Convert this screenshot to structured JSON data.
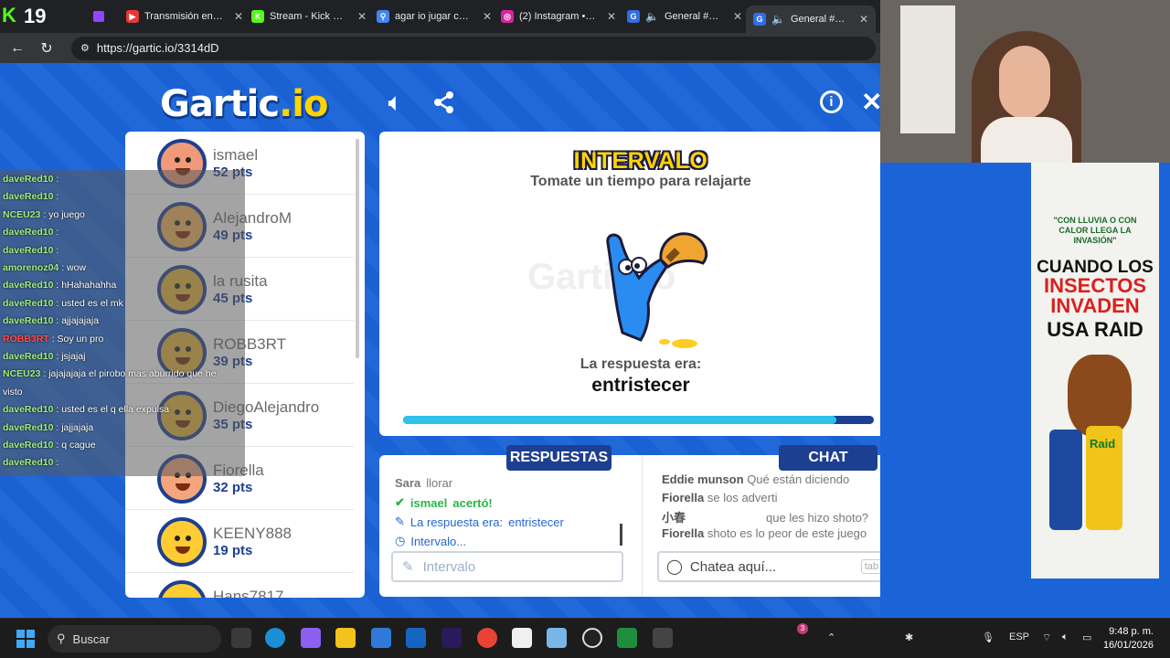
{
  "browser": {
    "stream_number": "19",
    "tabs": [
      {
        "label": "Transmisión en vivo",
        "fav_color": "#e53935",
        "fav_glyph": "▶"
      },
      {
        "label": "Stream - Kick Dash",
        "fav_color": "#53fc18",
        "fav_glyph": "K"
      },
      {
        "label": "agar io jugar con a",
        "fav_color": "#4285f4",
        "fav_glyph": "⚲"
      },
      {
        "label": "(2) Instagram • Me",
        "fav_color": "#d6249f",
        "fav_glyph": "◎"
      },
      {
        "label": "General #4dD",
        "fav_color": "#2f6ee8",
        "fav_glyph": "G"
      },
      {
        "label": "General #4dD",
        "fav_color": "#2f6ee8",
        "fav_glyph": "G"
      }
    ],
    "url": "https://gartic.io/3314dD"
  },
  "game": {
    "logo_main": "Gartic",
    "logo_suffix": ".io",
    "players": [
      {
        "name": "ismael",
        "points": "52 pts",
        "skin": "#f19a7a"
      },
      {
        "name": "AlejandroM",
        "points": "49 pts",
        "skin": "#f4b35a"
      },
      {
        "name": "la rusita",
        "points": "45 pts",
        "skin": "#e7b53a"
      },
      {
        "name": "ROBB3RT",
        "points": "39 pts",
        "skin": "#e7b53a"
      },
      {
        "name": "DiegoAlejandro",
        "points": "35 pts",
        "skin": "#e7b53a"
      },
      {
        "name": "Fiorella",
        "points": "32 pts",
        "skin": "#f3a67d"
      },
      {
        "name": "KEENY888",
        "points": "19 pts",
        "skin": "#ffcc33"
      },
      {
        "name": "Hans7817",
        "points": "",
        "skin": "#ffcc33"
      }
    ],
    "panel": {
      "title": "INTERVALO",
      "subtitle": "Tomate un tiempo para relajarte",
      "watermark": "Gartic.io",
      "answer_label": "La respuesta era:",
      "answer_word": "entristecer",
      "timer_fraction": 0.92
    },
    "answers": {
      "tab_label": "RESPUESTAS",
      "lines": [
        {
          "user": "Sara",
          "text": "llorar"
        },
        {
          "user": "ismael",
          "text": "acertó!"
        },
        {
          "prefix": "La respuesta era:",
          "word": "entristecer"
        },
        {
          "text": "Intervalo..."
        }
      ],
      "input_placeholder": "Intervalo"
    },
    "chat": {
      "tab_label": "CHAT",
      "lines": [
        {
          "user": "Eddie munson",
          "text": "Qué están diciendo"
        },
        {
          "user": "Fiorella",
          "text": "se los adverti"
        },
        {
          "user": "小春",
          "text": "que les hizo shoto?"
        },
        {
          "user": "Fiorella",
          "text": "shoto es lo peor de este juego"
        }
      ],
      "input_placeholder": "Chatea aquí...",
      "tab_key": "tab"
    }
  },
  "stream_chat": [
    {
      "user": "daveRed10",
      "text": ":"
    },
    {
      "user": "daveRed10",
      "text": ":"
    },
    {
      "user": "NCEU23",
      "text": ": yo juego"
    },
    {
      "user": "daveRed10",
      "text": ":"
    },
    {
      "user": "daveRed10",
      "text": ":"
    },
    {
      "user": "amorenoz04",
      "text": ": wow"
    },
    {
      "user": "daveRed10",
      "text": ": hHahahahha"
    },
    {
      "user": "daveRed10",
      "text": ": usted es el mk"
    },
    {
      "user": "daveRed10",
      "text": ": ajjajajaja"
    },
    {
      "user": "ROBB3RT",
      "text": ": Soy un pro"
    },
    {
      "user": "daveRed10",
      "text": ": jsjajaj"
    },
    {
      "user": "NCEU23",
      "text": ": jajajajaja el pirobo mas aburrido que he"
    },
    {
      "user": "",
      "text": "visto"
    },
    {
      "user": "daveRed10",
      "text": ": usted es el q ella expulsa"
    },
    {
      "user": "daveRed10",
      "text": ": jajjajaja"
    },
    {
      "user": "daveRed10",
      "text": ": q cague"
    },
    {
      "user": "daveRed10",
      "text": ":"
    }
  ],
  "ad": {
    "quote": "\"CON LLUVIA O CON CALOR LLEGA LA INVASIÓN\"",
    "headline": "CUANDO LOS",
    "headline_red": "INSECTOS INVADEN",
    "headline_end": "USA RAID",
    "brand": "Raid"
  },
  "taskbar": {
    "search_placeholder": "Buscar",
    "language": "ESP",
    "time": "9:48 p. m.",
    "date": "16/01/2026",
    "notification_count": "3"
  }
}
